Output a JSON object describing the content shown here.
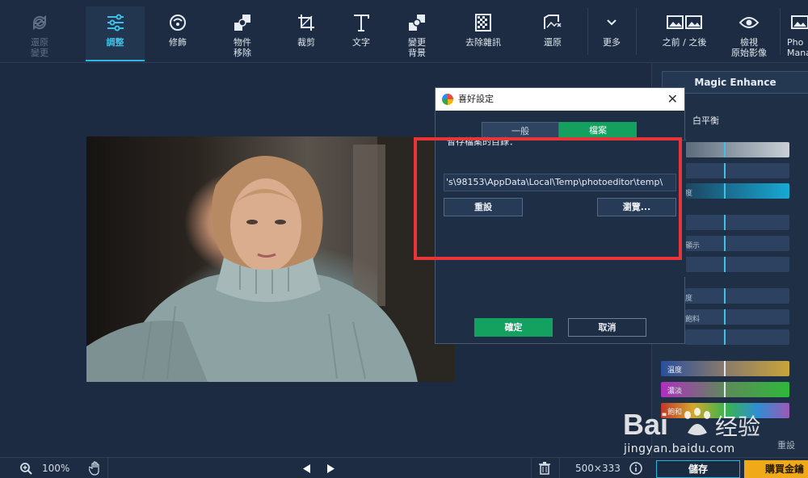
{
  "toolbar": {
    "items": [
      {
        "label": "還原\n變更",
        "icon": "undo-icon"
      },
      {
        "label": "調整",
        "icon": "sliders-icon"
      },
      {
        "label": "修飾",
        "icon": "face-icon"
      },
      {
        "label": "物件\n移除",
        "icon": "object-remove-icon"
      },
      {
        "label": "裁剪",
        "icon": "crop-icon"
      },
      {
        "label": "文字",
        "icon": "text-icon"
      },
      {
        "label": "變更\n背景",
        "icon": "background-icon"
      },
      {
        "label": "去除雜訊",
        "icon": "denoise-icon"
      },
      {
        "label": "還原",
        "icon": "restore-icon"
      },
      {
        "label": "更多",
        "icon": "chevron-down-icon"
      },
      {
        "label": "之前 / 之後",
        "icon": "before-after-icon"
      },
      {
        "label": "檢視\n原始影像",
        "icon": "eye-icon"
      },
      {
        "label": "Pho\nMana",
        "icon": "photo-manager-icon"
      }
    ],
    "accent": "#2fb5e0"
  },
  "right_panel": {
    "magic_enhance": "Magic Enhance",
    "white_balance": "白平衡",
    "partial_labels": [
      "度",
      "顯示",
      "度",
      "飽料"
    ],
    "color_sliders": [
      "溫度",
      "濃淡",
      "飽和"
    ],
    "reset": "重設"
  },
  "dialog": {
    "title": "喜好設定",
    "close": "✕",
    "tabs": [
      {
        "label": "一般",
        "active": false
      },
      {
        "label": "檔案",
        "active": true
      }
    ],
    "save_dir_label": "暫存檔案的目錄：",
    "save_dir_value": "'s\\98153\\AppData\\Local\\Temp\\photoeditor\\temp\\",
    "reset_button": "重設",
    "browse_button": "瀏覽...",
    "ok_button": "確定",
    "cancel_button": "取消",
    "accent_green": "#14a05f"
  },
  "bottom_bar": {
    "zoom": "100%",
    "dimensions": "500×333",
    "save": "儲存",
    "buy": "購買金鑰"
  },
  "watermark": {
    "text": "jingyan.baidu.com",
    "logo": "Bai经验"
  },
  "colors": {
    "highlight_red": "#e8353a",
    "buy_orange": "#f0a919"
  }
}
